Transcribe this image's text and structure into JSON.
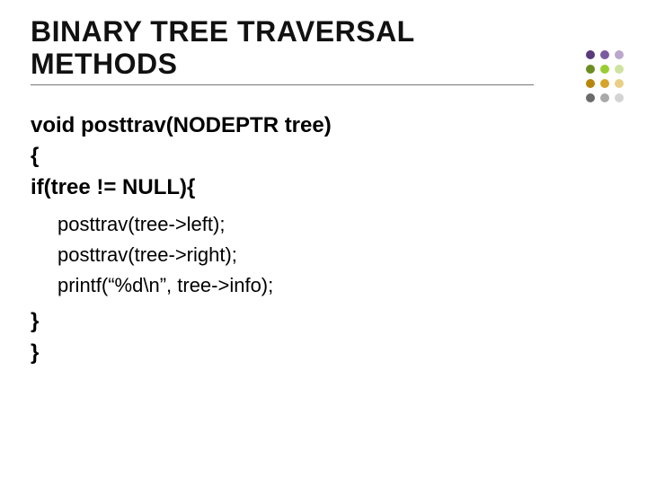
{
  "title": "BINARY TREE TRAVERSAL METHODS",
  "code": {
    "l1": "void posttrav(NODEPTR tree)",
    "l2": "{",
    "l3": "if(tree != NULL){",
    "l4": "posttrav(tree->left);",
    "l5": "posttrav(tree->right);",
    "l6": "printf(“%d\\n”, tree->info);",
    "l7": "}",
    "l8": "}"
  },
  "decor": {
    "rows": [
      [
        "#5a3a7a",
        "#7a5aa0",
        "#b9a7cc"
      ],
      [
        "#6b8e23",
        "#9acd32",
        "#cfe3a1"
      ],
      [
        "#b8860b",
        "#d4a52a",
        "#e9cf86"
      ],
      [
        "#6b6b6b",
        "#a9a9a9",
        "#d4d4d4"
      ]
    ]
  }
}
